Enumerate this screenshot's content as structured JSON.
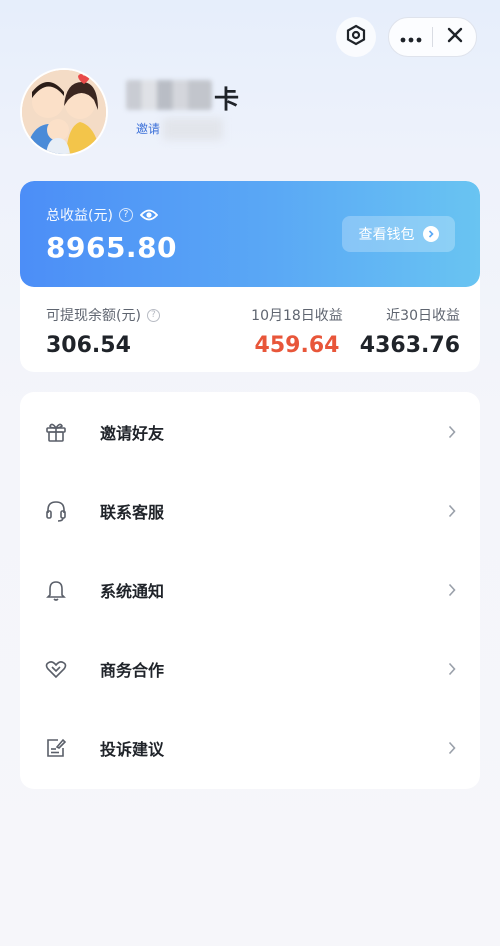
{
  "topbar": {
    "ring_icon": "hexagon-ring-icon",
    "more_icon": "more-dots-icon",
    "close_icon": "close-icon"
  },
  "profile": {
    "avatar_icon": "family-avatar-illustration",
    "name_suffix": "卡",
    "invite_prefix": "邀请"
  },
  "earnings": {
    "total_label": "总收益(元)",
    "total_value": "8965.80",
    "wallet_button": "查看钱包",
    "accent_colors": [
      "#4c8ef7",
      "#69c4f2"
    ],
    "withdrawable_label": "可提现余额(元)",
    "withdrawable_value": "306.54",
    "daily_label": "10月18日收益",
    "daily_value": "459.64",
    "daily_color": "#e8563a",
    "month_label": "近30日收益",
    "month_value": "4363.76"
  },
  "menu": {
    "items": [
      {
        "label": "邀请好友",
        "icon": "gift-icon"
      },
      {
        "label": "联系客服",
        "icon": "headset-icon"
      },
      {
        "label": "系统通知",
        "icon": "bell-icon"
      },
      {
        "label": "商务合作",
        "icon": "heart-handshake-icon"
      },
      {
        "label": "投诉建议",
        "icon": "feedback-edit-icon"
      }
    ]
  }
}
